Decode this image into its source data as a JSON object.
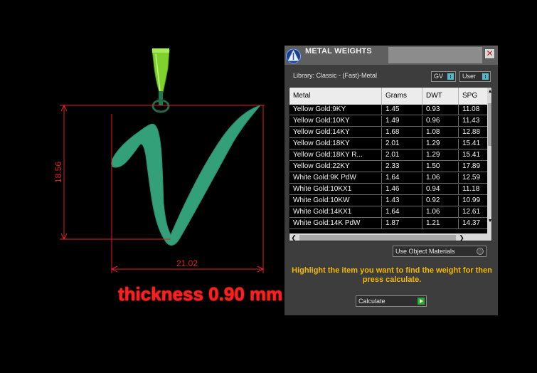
{
  "viewport": {
    "dimension_height": "18.56",
    "dimension_width": "21.02",
    "thickness_label": "thickness 0.90 mm",
    "colors": {
      "pendant": "#33a07a",
      "bail": "#7fd12e",
      "dimension": "#e02020"
    }
  },
  "panel": {
    "title": "METAL WEIGHTS",
    "library": "Library: Classic - (Fast)-Metal",
    "gv_label": "GV",
    "user_label": "User",
    "table": {
      "headers": [
        "Metal",
        "Grams",
        "DWT",
        "SPG"
      ],
      "rows": [
        [
          "Yellow Gold:9KY",
          "1.45",
          "0.93",
          "11.08"
        ],
        [
          "Yellow Gold:10KY",
          "1.49",
          "0.96",
          "11.43"
        ],
        [
          "Yellow Gold:14KY",
          "1.68",
          "1.08",
          "12.88"
        ],
        [
          "Yellow Gold:18KY",
          "2.01",
          "1.29",
          "15.41"
        ],
        [
          "Yellow Gold:18KY R...",
          "2.01",
          "1.29",
          "15.41"
        ],
        [
          "Yellow Gold:22KY",
          "2.33",
          "1.50",
          "17.89"
        ],
        [
          "White Gold:9K PdW",
          "1.64",
          "1.06",
          "12.59"
        ],
        [
          "White Gold:10KX1",
          "1.46",
          "0.94",
          "11.18"
        ],
        [
          "White Gold:10KW",
          "1.43",
          "0.92",
          "10.99"
        ],
        [
          "White Gold:14KX1",
          "1.64",
          "1.06",
          "12.61"
        ],
        [
          "White Gold:14K PdW",
          "1.87",
          "1.21",
          "14.37"
        ]
      ]
    },
    "use_object_materials": "Use Object Materials",
    "hint": "Highlight the item you want to find the weight for then press calculate.",
    "calculate_label": "Calculate",
    "colors": {
      "accent": "#53b8c7",
      "hint": "#f5b800",
      "play": "#2fa82f"
    }
  }
}
